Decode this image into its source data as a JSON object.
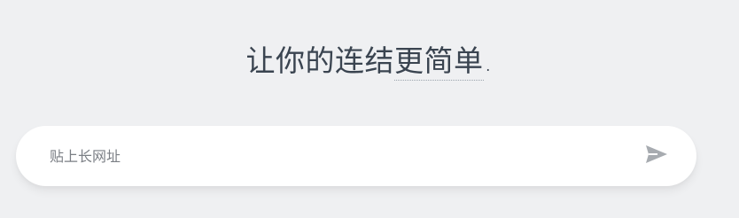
{
  "headline": {
    "prefix": "让你的连结",
    "emphasis": "更简单",
    "suffix": "."
  },
  "url_input": {
    "placeholder": "贴上长网址",
    "value": ""
  },
  "submit": {
    "icon": "send-icon",
    "color": "#a7abb0"
  }
}
